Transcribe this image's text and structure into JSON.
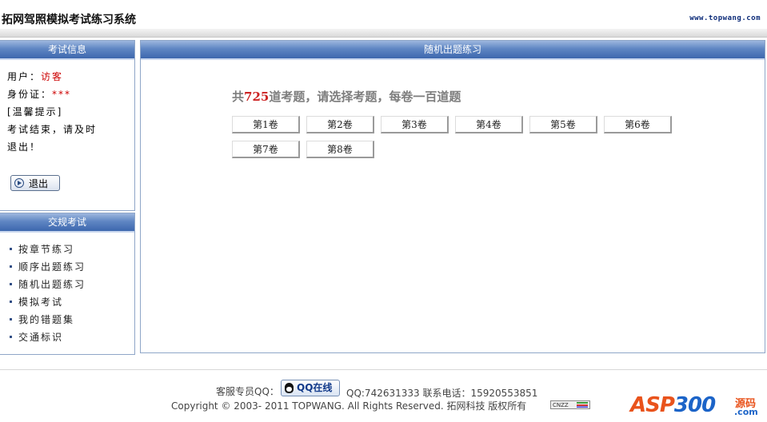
{
  "header": {
    "title": "拓网驾照模拟考试练习系统",
    "url": "www.topwang.com"
  },
  "exam_info": {
    "heading": "考试信息",
    "user_label": "用户：",
    "user_value": "访客",
    "id_label": "身份证：",
    "id_value": "***",
    "tip_title": "[温馨提示]",
    "tip_line1": "考试结束，请及时",
    "tip_line2": "退出！",
    "logout_label": "退出"
  },
  "traffic_exam": {
    "heading": "交规考试",
    "items": [
      {
        "label": "按章节练习"
      },
      {
        "label": "顺序出题练习"
      },
      {
        "label": "随机出题练习"
      },
      {
        "label": "模拟考试"
      },
      {
        "label": "我的错题集"
      },
      {
        "label": "交通标识"
      }
    ]
  },
  "main": {
    "heading": "随机出题练习",
    "intro_prefix": "共",
    "question_count": "725",
    "intro_suffix": "道考题，请选择考题，每卷一百道题",
    "papers": [
      {
        "label": "第1卷"
      },
      {
        "label": "第2卷"
      },
      {
        "label": "第3卷"
      },
      {
        "label": "第4卷"
      },
      {
        "label": "第5卷"
      },
      {
        "label": "第6卷"
      },
      {
        "label": "第7卷"
      },
      {
        "label": "第8卷"
      }
    ]
  },
  "footer": {
    "service_label": "客服专员QQ：",
    "qq_button": "QQ在线",
    "qq_and_phone": "QQ:742631333  联系电话：15920553851",
    "copyright": "Copyright © 2003- 2011 TOPWANG. All Rights Reserved. 拓网科技 版权所有",
    "counter_badge": "CNZZ"
  },
  "watermark": {
    "asp": "ASP",
    "num": "300",
    "ym": "源码",
    "com": ".com"
  }
}
